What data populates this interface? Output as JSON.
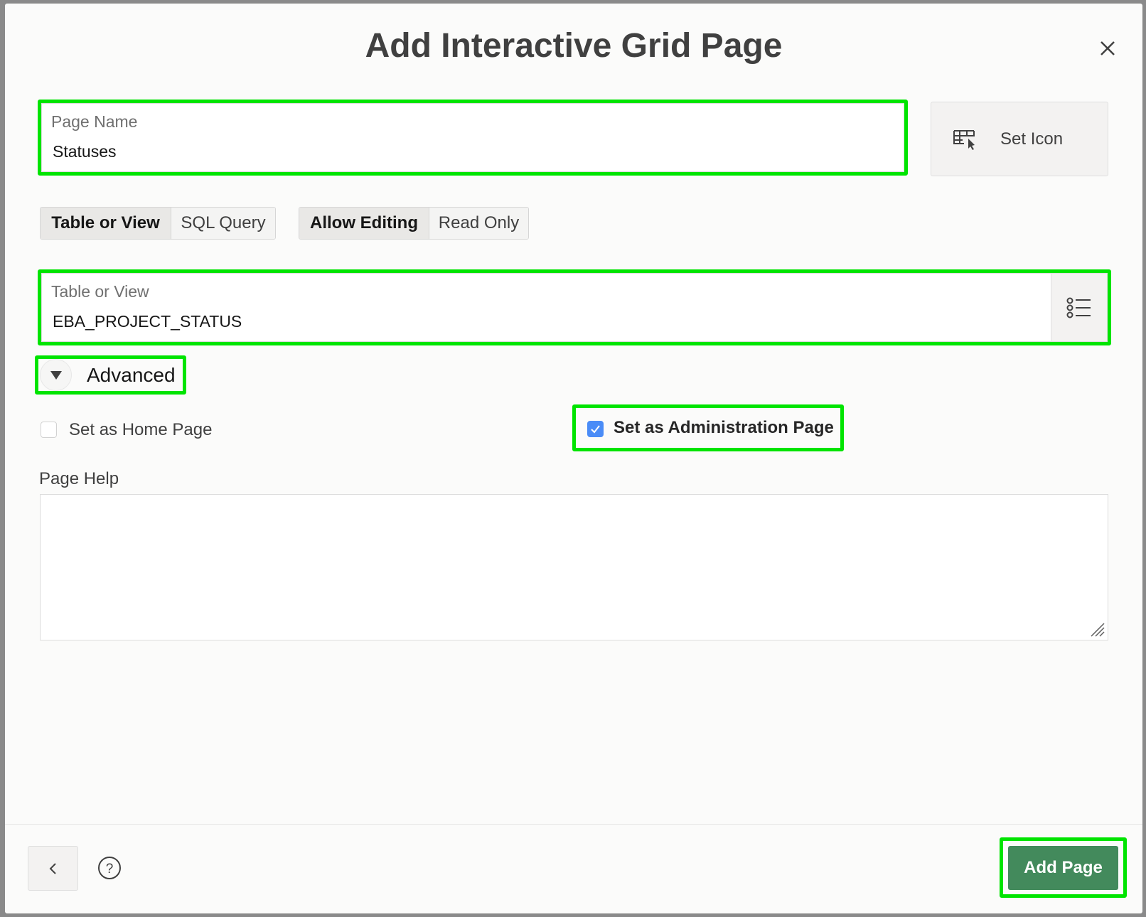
{
  "dialog": {
    "title": "Add Interactive Grid Page",
    "close_icon": "close-icon"
  },
  "page_name": {
    "label": "Page Name",
    "value": "Statuses"
  },
  "set_icon": {
    "label": "Set Icon",
    "icon": "table-pointer-icon"
  },
  "source_toggle": {
    "options": [
      "Table or View",
      "SQL Query"
    ],
    "selected": "Table or View"
  },
  "edit_toggle": {
    "options": [
      "Allow Editing",
      "Read Only"
    ],
    "selected": "Allow Editing"
  },
  "table_or_view": {
    "label": "Table or View",
    "value": "EBA_PROJECT_STATUS",
    "icon": "list-icon"
  },
  "advanced": {
    "label": "Advanced",
    "expanded": true
  },
  "home_page": {
    "label": "Set as Home Page",
    "checked": false
  },
  "admin_page": {
    "label": "Set as Administration Page",
    "checked": true
  },
  "page_help": {
    "label": "Page Help",
    "value": ""
  },
  "footer": {
    "add_page": "Add Page",
    "accent": "#438a5c"
  },
  "colors": {
    "highlight": "#00e400",
    "checkbox": "#4a8cf7"
  }
}
